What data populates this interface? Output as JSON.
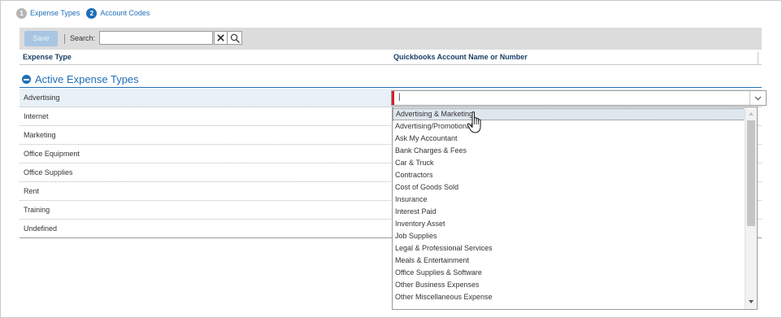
{
  "steps": [
    {
      "number": "1",
      "label": "Expense Types"
    },
    {
      "number": "2",
      "label": "Account Codes"
    }
  ],
  "toolbar": {
    "save_label": "Save",
    "search_label": "Search:",
    "search_value": "",
    "clear_icon": "close-icon",
    "search_icon": "search-icon"
  },
  "table": {
    "columns": [
      "Expense Type",
      "Quickbooks Account Name or Number"
    ],
    "section_title": "Active Expense Types",
    "rows": [
      "Advertising",
      "Internet",
      "Marketing",
      "Office Equipment",
      "Office Supplies",
      "Rent",
      "Training",
      "Undefined"
    ],
    "selected_row": "Advertising"
  },
  "combo": {
    "value": "|",
    "options": [
      "Advertising & Marketing",
      "Advertising/Promotional",
      "Ask My Accountant",
      "Bank Charges & Fees",
      "Car & Truck",
      "Contractors",
      "Cost of Goods Sold",
      "Insurance",
      "Interest Paid",
      "Inventory Asset",
      "Job Supplies",
      "Legal & Professional Services",
      "Meals & Entertainment",
      "Office Supplies & Software",
      "Other Business Expenses",
      "Other Miscellaneous Expense"
    ],
    "highlighted_option": "Advertising & Marketing"
  },
  "colors": {
    "accent": "#1f6fb6",
    "required": "#d2232a",
    "toolbar_bg": "#dcdcdc",
    "selected_row_bg": "#e8f1f8"
  }
}
